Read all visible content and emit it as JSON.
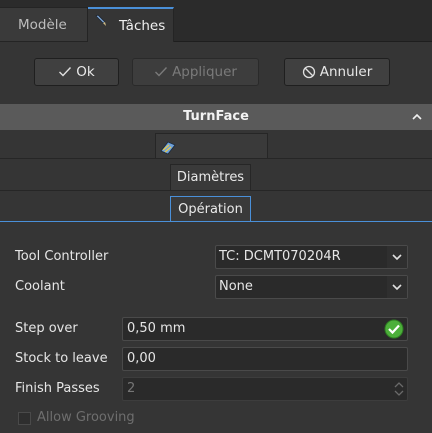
{
  "tabs": {
    "model": "Modèle",
    "tasks": "Tâches"
  },
  "buttons": {
    "ok": "Ok",
    "apply": "Appliquer",
    "cancel": "Annuler"
  },
  "panel": {
    "title": "TurnFace"
  },
  "toolbox": {
    "diameters": "Diamètres",
    "operation": "Opération"
  },
  "form": {
    "tool_controller": {
      "label": "Tool Controller",
      "value": "TC: DCMT070204R"
    },
    "coolant": {
      "label": "Coolant",
      "value": "None"
    },
    "step_over": {
      "label": "Step over",
      "value": "0,50 mm"
    },
    "stock_to_leave": {
      "label": "Stock to leave",
      "value": "0,00"
    },
    "finish_passes": {
      "label": "Finish Passes",
      "value": "2"
    },
    "allow_grooving": {
      "label": "Allow Grooving",
      "checked": false
    }
  },
  "colors": {
    "accent": "#4a90d9",
    "valid": "#4caf3a"
  }
}
